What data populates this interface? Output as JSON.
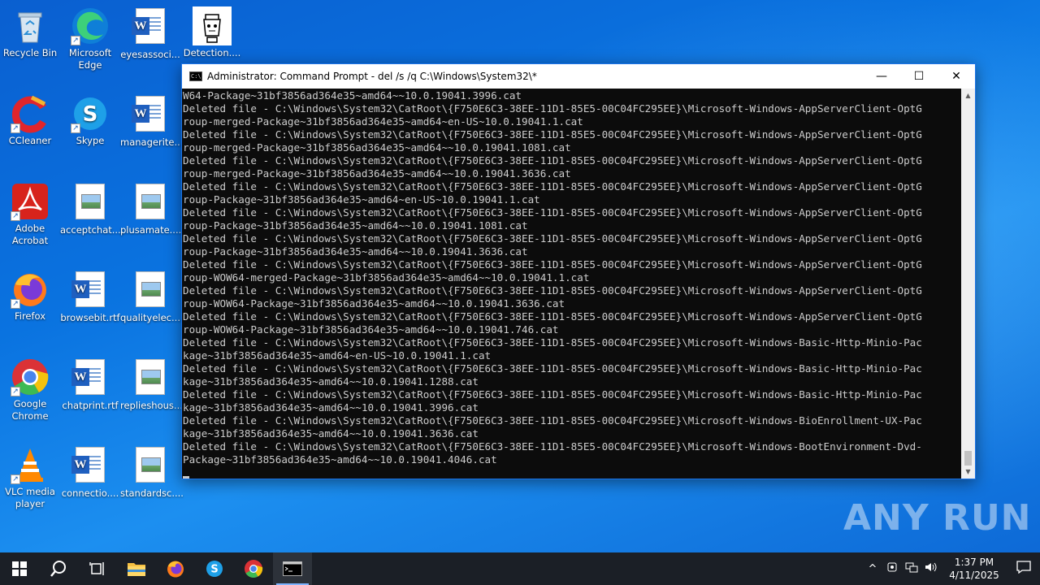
{
  "desktop": {
    "icons": [
      {
        "label": "Recycle Bin"
      },
      {
        "label": "Microsoft Edge"
      },
      {
        "label": "eyesassoci..."
      },
      {
        "label": "Detection...."
      },
      {
        "label": "CCleaner"
      },
      {
        "label": "Skype"
      },
      {
        "label": "managerite..."
      },
      {
        "label": "Adobe Acrobat"
      },
      {
        "label": "acceptchat...."
      },
      {
        "label": "plusamate...."
      },
      {
        "label": "Firefox"
      },
      {
        "label": "browsebit.rtf"
      },
      {
        "label": "qualityelec...."
      },
      {
        "label": "Google Chrome"
      },
      {
        "label": "chatprint.rtf"
      },
      {
        "label": "replieshous...."
      },
      {
        "label": "VLC media player"
      },
      {
        "label": "connectio...."
      },
      {
        "label": "standardsc...."
      }
    ]
  },
  "cmd": {
    "title": "Administrator: Command Prompt - del  /s /q C:\\Windows\\System32\\*",
    "output": "W64-Package~31bf3856ad364e35~amd64~~10.0.19041.3996.cat\nDeleted file - C:\\Windows\\System32\\CatRoot\\{F750E6C3-38EE-11D1-85E5-00C04FC295EE}\\Microsoft-Windows-AppServerClient-OptG\nroup-merged-Package~31bf3856ad364e35~amd64~en-US~10.0.19041.1.cat\nDeleted file - C:\\Windows\\System32\\CatRoot\\{F750E6C3-38EE-11D1-85E5-00C04FC295EE}\\Microsoft-Windows-AppServerClient-OptG\nroup-merged-Package~31bf3856ad364e35~amd64~~10.0.19041.1081.cat\nDeleted file - C:\\Windows\\System32\\CatRoot\\{F750E6C3-38EE-11D1-85E5-00C04FC295EE}\\Microsoft-Windows-AppServerClient-OptG\nroup-merged-Package~31bf3856ad364e35~amd64~~10.0.19041.3636.cat\nDeleted file - C:\\Windows\\System32\\CatRoot\\{F750E6C3-38EE-11D1-85E5-00C04FC295EE}\\Microsoft-Windows-AppServerClient-OptG\nroup-Package~31bf3856ad364e35~amd64~en-US~10.0.19041.1.cat\nDeleted file - C:\\Windows\\System32\\CatRoot\\{F750E6C3-38EE-11D1-85E5-00C04FC295EE}\\Microsoft-Windows-AppServerClient-OptG\nroup-Package~31bf3856ad364e35~amd64~~10.0.19041.1081.cat\nDeleted file - C:\\Windows\\System32\\CatRoot\\{F750E6C3-38EE-11D1-85E5-00C04FC295EE}\\Microsoft-Windows-AppServerClient-OptG\nroup-Package~31bf3856ad364e35~amd64~~10.0.19041.3636.cat\nDeleted file - C:\\Windows\\System32\\CatRoot\\{F750E6C3-38EE-11D1-85E5-00C04FC295EE}\\Microsoft-Windows-AppServerClient-OptG\nroup-WOW64-merged-Package~31bf3856ad364e35~amd64~~10.0.19041.1.cat\nDeleted file - C:\\Windows\\System32\\CatRoot\\{F750E6C3-38EE-11D1-85E5-00C04FC295EE}\\Microsoft-Windows-AppServerClient-OptG\nroup-WOW64-Package~31bf3856ad364e35~amd64~~10.0.19041.3636.cat\nDeleted file - C:\\Windows\\System32\\CatRoot\\{F750E6C3-38EE-11D1-85E5-00C04FC295EE}\\Microsoft-Windows-AppServerClient-OptG\nroup-WOW64-Package~31bf3856ad364e35~amd64~~10.0.19041.746.cat\nDeleted file - C:\\Windows\\System32\\CatRoot\\{F750E6C3-38EE-11D1-85E5-00C04FC295EE}\\Microsoft-Windows-Basic-Http-Minio-Pac\nkage~31bf3856ad364e35~amd64~en-US~10.0.19041.1.cat\nDeleted file - C:\\Windows\\System32\\CatRoot\\{F750E6C3-38EE-11D1-85E5-00C04FC295EE}\\Microsoft-Windows-Basic-Http-Minio-Pac\nkage~31bf3856ad364e35~amd64~~10.0.19041.1288.cat\nDeleted file - C:\\Windows\\System32\\CatRoot\\{F750E6C3-38EE-11D1-85E5-00C04FC295EE}\\Microsoft-Windows-Basic-Http-Minio-Pac\nkage~31bf3856ad364e35~amd64~~10.0.19041.3996.cat\nDeleted file - C:\\Windows\\System32\\CatRoot\\{F750E6C3-38EE-11D1-85E5-00C04FC295EE}\\Microsoft-Windows-BioEnrollment-UX-Pac\nkage~31bf3856ad364e35~amd64~~10.0.19041.3636.cat\nDeleted file - C:\\Windows\\System32\\CatRoot\\{F750E6C3-38EE-11D1-85E5-00C04FC295EE}\\Microsoft-Windows-BootEnvironment-Dvd-\nPackage~31bf3856ad364e35~amd64~~10.0.19041.4046.cat",
    "minimize": "—",
    "maximize": "☐",
    "close": "✕",
    "app_icon_text": "C:\\"
  },
  "watermark": "ANY RUN",
  "taskbar": {
    "clock_time": "1:37 PM",
    "clock_date": "4/11/2025",
    "tray_chevron": "^"
  }
}
